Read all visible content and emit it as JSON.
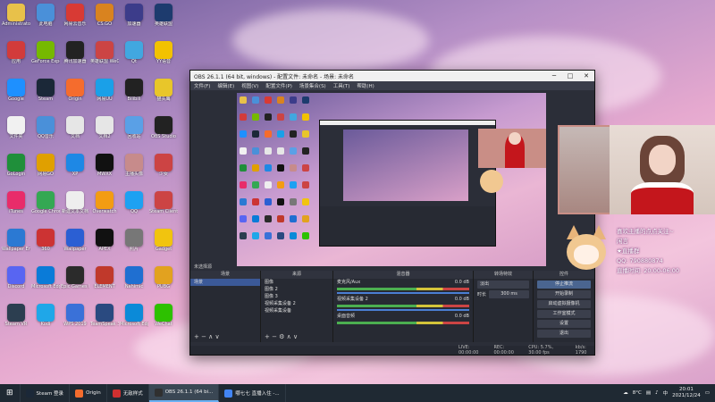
{
  "obs": {
    "title": "OBS 26.1.1 (64 bit, windows) - 配置文件: 未命名 - 场景: 未命名",
    "menu": [
      "文件(F)",
      "编辑(E)",
      "视图(V)",
      "配置文件(P)",
      "场景集合(S)",
      "工具(T)",
      "帮助(H)"
    ],
    "docks": {
      "scenes": {
        "title": "场景",
        "items": [
          "场景"
        ]
      },
      "sources": {
        "title": "来源",
        "items": [
          "图像",
          "图像 2",
          "图像 3",
          "视频采集设备 2",
          "视频采集设备"
        ]
      },
      "mixer": {
        "title": "混音器",
        "tracks": [
          {
            "name": "麦克风/Aux",
            "db": "0.0 dB"
          },
          {
            "name": "视频采集设备 2",
            "db": "0.0 dB"
          },
          {
            "name": "桌面音频",
            "db": "0.0 dB"
          }
        ]
      },
      "transitions": {
        "title": "转场特效",
        "type": "淡出",
        "duration_label": "时长",
        "duration": "300 ms"
      },
      "controls": {
        "title": "控件",
        "buttons": [
          "停止推流",
          "开始录制",
          "启动虚拟摄像机",
          "工作室模式",
          "设置",
          "退出"
        ]
      }
    },
    "status": {
      "live": "LIVE: 00:00:00",
      "rec": "REC: 00:00:00",
      "cpu": "CPU: 5.7%, 30.00 fps",
      "extra": "kb/s: 1790"
    }
  },
  "welcome": {
    "lines": [
      "喜欢主播的点点关注~",
      "闲言",
      "★直播群",
      "QQ: 790880874",
      "直播时间: 20:00-06:00"
    ]
  },
  "taskbar": {
    "apps": [
      {
        "label": "Steam 登录",
        "color": "#1b2838",
        "active": false
      },
      {
        "label": "Origin",
        "color": "#f56c2d",
        "active": false
      },
      {
        "label": "无敌样式",
        "color": "#d03030",
        "active": false
      },
      {
        "label": "OBS 26.1.1 (64 bi...",
        "color": "#303030",
        "active": true
      },
      {
        "label": "哪七七 直播入住 -...",
        "color": "#4285f4",
        "active": false
      }
    ],
    "tray": {
      "weather": "8°C",
      "ime": "中",
      "time": "20:01",
      "date": "2021/12/24"
    }
  },
  "desktop": {
    "icons": [
      {
        "label": "Administrator",
        "color": "#e8c14a"
      },
      {
        "label": "此电脑",
        "color": "#4a90d9"
      },
      {
        "label": "网易云音乐",
        "color": "#d83a34"
      },
      {
        "label": "CS:GO",
        "color": "#d9831f"
      },
      {
        "label": "加速器",
        "color": "#3c3c8a"
      },
      {
        "label": "英雄联盟",
        "color": "#1d3b6e"
      },
      {
        "label": "应用",
        "color": "#d23b3b"
      },
      {
        "label": "GeForce Experience",
        "color": "#76b900"
      },
      {
        "label": "腾讯加速器",
        "color": "#222"
      },
      {
        "label": "英雄联盟 WeGame",
        "color": "#c44"
      },
      {
        "label": "Qt",
        "color": "#41a7e0"
      },
      {
        "label": "YY语音",
        "color": "#f2c200"
      },
      {
        "label": "Google",
        "color": "#1e90ff"
      },
      {
        "label": "Steam",
        "color": "#1b2838"
      },
      {
        "label": "Origin",
        "color": "#f56c2d"
      },
      {
        "label": "网易UU",
        "color": "#1aa0e8"
      },
      {
        "label": "Bilibili",
        "color": "#222"
      },
      {
        "label": "猫头鹰",
        "color": "#e8c62a"
      },
      {
        "label": "文件夹",
        "color": "#f1f1f1"
      },
      {
        "label": "QQ音乐",
        "color": "#4a90d9"
      },
      {
        "label": "文档",
        "color": "#e6e6e6"
      },
      {
        "label": "文档2",
        "color": "#e6e6e6"
      },
      {
        "label": "回收站",
        "color": "#5aa0e6"
      },
      {
        "label": "OBS Studio",
        "color": "#222"
      },
      {
        "label": "GoLogin",
        "color": "#1f8f3a"
      },
      {
        "label": "网易GO",
        "color": "#e0a000"
      },
      {
        "label": "XP",
        "color": "#1e88e5"
      },
      {
        "label": "MWXX",
        "color": "#111"
      },
      {
        "label": "主播头像",
        "color": "#c78b8b"
      },
      {
        "label": "少女",
        "color": "#c44"
      },
      {
        "label": "iTunes",
        "color": "#e82c6a"
      },
      {
        "label": "Google Chrome",
        "color": "#34a853"
      },
      {
        "label": "新建文本文档",
        "color": "#eee"
      },
      {
        "label": "Overwatch",
        "color": "#f39c12"
      },
      {
        "label": "QQ",
        "color": "#1da1f2"
      },
      {
        "label": "Steam Client",
        "color": "#c44"
      },
      {
        "label": "Wallpaper Engine",
        "color": "#2b79d3"
      },
      {
        "label": "360",
        "color": "#c33"
      },
      {
        "label": "Wallpaper",
        "color": "#2b5fd3"
      },
      {
        "label": "APEX",
        "color": "#111"
      },
      {
        "label": "照片",
        "color": "#777"
      },
      {
        "label": "Gadget",
        "color": "#f1c40f"
      },
      {
        "label": "Discord",
        "color": "#5865f2"
      },
      {
        "label": "Microsoft Edge",
        "color": "#0a7bd8"
      },
      {
        "label": "Epic Games Launcher",
        "color": "#2b2b2b"
      },
      {
        "label": "ELEMENT",
        "color": "#c0392b"
      },
      {
        "label": "Nahimic",
        "color": "#1f6fd1"
      },
      {
        "label": "PUBG",
        "color": "#e2a21f"
      },
      {
        "label": "Steam VR",
        "color": "#2c3e50"
      },
      {
        "label": "Kodi",
        "color": "#1fa7e8"
      },
      {
        "label": "WPS 2019",
        "color": "#3a71d8"
      },
      {
        "label": "TeamSpeak 3",
        "color": "#2a4a80"
      },
      {
        "label": "Microsoft Edge 2",
        "color": "#0b8ad8"
      },
      {
        "label": "WeChat",
        "color": "#2dc100"
      }
    ]
  }
}
